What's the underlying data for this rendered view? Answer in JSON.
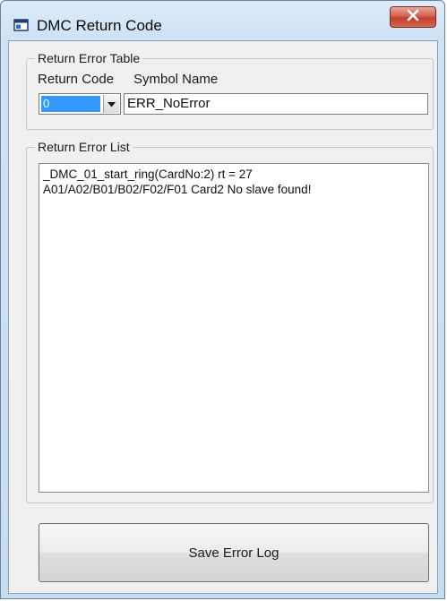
{
  "window": {
    "title": "DMC Return Code"
  },
  "return_error_table": {
    "group_label": "Return Error Table",
    "return_code_label": "Return Code",
    "symbol_name_label": "Symbol Name",
    "return_code_value": "0",
    "symbol_name_value": "ERR_NoError"
  },
  "return_error_list": {
    "group_label": "Return Error List",
    "lines": [
      "_DMC_01_start_ring(CardNo:2)  rt = 27",
      "A01/A02/B01/B02/F02/F01 Card2 No slave found!"
    ]
  },
  "actions": {
    "save_label": "Save Error Log"
  },
  "icons": {
    "app": "window-app-icon",
    "close": "close-icon",
    "dropdown": "chevron-down-icon"
  },
  "colors": {
    "close_button": "#c9452f",
    "selection": "#3399ff"
  }
}
